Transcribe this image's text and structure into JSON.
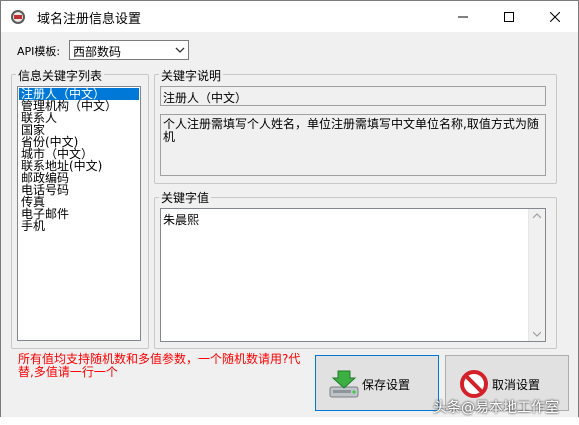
{
  "window": {
    "title": "域名注册信息设置",
    "icon": "app-icon",
    "controls": [
      "minimize-icon",
      "maximize-icon",
      "close-icon"
    ]
  },
  "template": {
    "label": "API模板:",
    "selected": "西部数码"
  },
  "keyword_list": {
    "legend": "信息关键字列表",
    "items": [
      "注册人（中文）",
      "管理机构（中文）",
      "联系人",
      "国家",
      "省份(中文)",
      "城市（中文）",
      "联系地址(中文)",
      "邮政编码",
      "电话号码",
      "传真",
      "电子邮件",
      "手机"
    ],
    "selected_index": 0
  },
  "keyword_desc": {
    "legend": "关键字说明",
    "name": "注册人（中文）",
    "description": "个人注册需填写个人姓名，单位注册需填写中文单位名称,取值方式为随机"
  },
  "keyword_value": {
    "legend": "关键字值",
    "value": "朱晨熙"
  },
  "notice": "所有值均支持随机数和多值参数，一个随机数请用?代替,多值请一行一个",
  "buttons": {
    "save": "保存设置",
    "cancel": "取消设置"
  },
  "watermark": "头条@易本地工作室",
  "colors": {
    "selection": "#0078d7",
    "notice": "#ff0000",
    "background": "#f0f0f0"
  }
}
